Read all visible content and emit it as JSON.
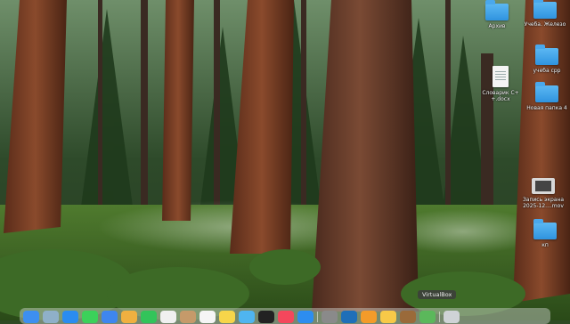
{
  "desktop": {
    "icons": [
      {
        "label": "Архив",
        "type": "folder",
        "icon": "folder-icon"
      },
      {
        "label": "Учеба. Железо",
        "type": "folder",
        "icon": "folder-icon"
      },
      {
        "label": "учеба срр",
        "type": "folder",
        "icon": "folder-icon"
      },
      {
        "label": "Словарик С+ +.docx",
        "type": "document",
        "icon": "document-icon"
      },
      {
        "label": "Новая папка 4",
        "type": "folder",
        "icon": "folder-icon"
      },
      {
        "label": "Запись экрана 2025-12....mov",
        "type": "movie",
        "icon": "movie-icon"
      },
      {
        "label": "кп",
        "type": "folder",
        "icon": "folder-icon"
      }
    ]
  },
  "dock": {
    "tooltip": "VirtualBox",
    "apps": [
      {
        "name": "finder",
        "color": "#3d8ff0"
      },
      {
        "name": "launchpad",
        "color": "#8fb0c8"
      },
      {
        "name": "safari",
        "color": "#2a8cf0"
      },
      {
        "name": "messages",
        "color": "#3bd15a"
      },
      {
        "name": "mail",
        "color": "#3e86ef"
      },
      {
        "name": "photos",
        "color": "#f0b040"
      },
      {
        "name": "facetime",
        "color": "#32c45a"
      },
      {
        "name": "calendar",
        "color": "#f0f0f0"
      },
      {
        "name": "contacts",
        "color": "#c59a6a"
      },
      {
        "name": "reminders",
        "color": "#f5f5f5"
      },
      {
        "name": "notes",
        "color": "#f6d54a"
      },
      {
        "name": "freeform",
        "color": "#4fb5f0"
      },
      {
        "name": "apple-tv",
        "color": "#222222"
      },
      {
        "name": "music",
        "color": "#f4475c"
      },
      {
        "name": "app-store",
        "color": "#2d8df0"
      },
      {
        "name": "settings",
        "color": "#8a8a8a"
      },
      {
        "name": "virtualbox",
        "color": "#1f6fb8"
      },
      {
        "name": "app-orange",
        "color": "#f39b2a"
      },
      {
        "name": "app-yellow",
        "color": "#f7c948"
      },
      {
        "name": "app-brown",
        "color": "#9a6a3a"
      },
      {
        "name": "app-green",
        "color": "#5bb85b"
      },
      {
        "name": "trash",
        "color": "#cfd3d6"
      }
    ]
  }
}
